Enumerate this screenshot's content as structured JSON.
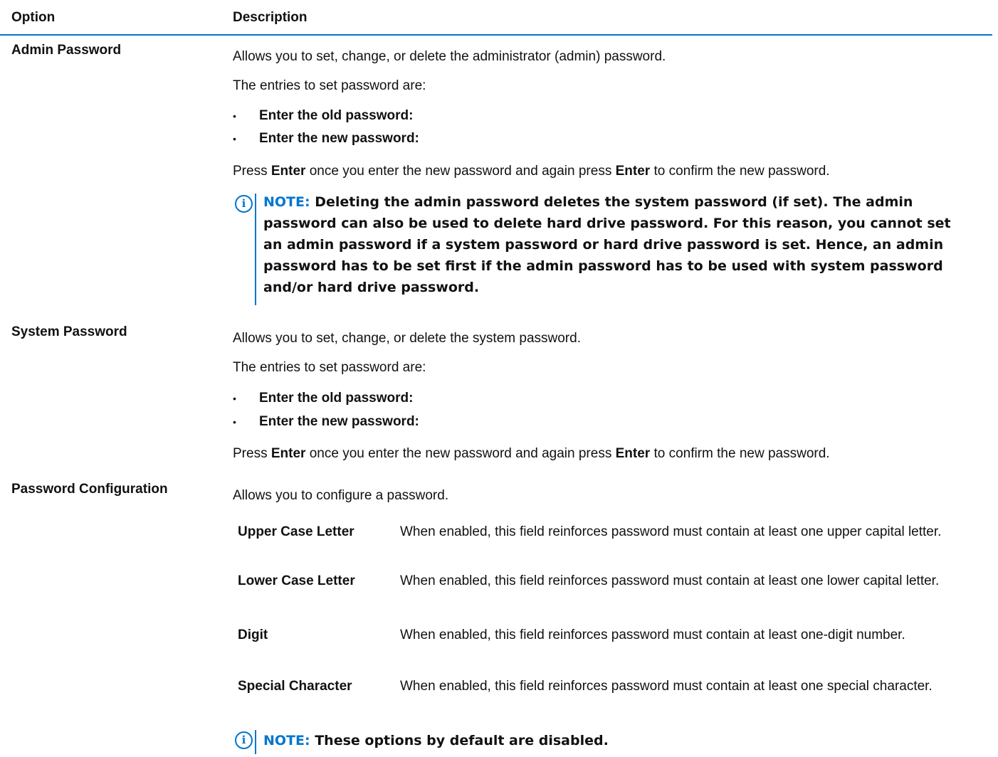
{
  "header": {
    "option": "Option",
    "description": "Description"
  },
  "admin": {
    "name": "Admin Password",
    "desc": "Allows you to set, change, or delete the administrator (admin) password.",
    "entries_intro": "The entries to set password are:",
    "bullets": [
      "Enter the old password:",
      "Enter the new password:"
    ],
    "press_pre": "Press ",
    "press_key1": "Enter",
    "press_mid": " once you enter the new password and again press ",
    "press_key2": "Enter",
    "press_post": " to confirm the new password.",
    "note_label": "NOTE:",
    "note_lines": [
      " Deleting the admin password deletes the system password (if set). The admin",
      "password can also be used to delete hard drive password. For this reason, you cannot set",
      "an admin password if a system password or hard drive password is set. Hence, an admin",
      "password has to be set first if the admin password has to be used with system password",
      "and/or hard drive password."
    ]
  },
  "system": {
    "name": "System Password",
    "desc": "Allows you to set, change, or delete the system password.",
    "entries_intro": "The entries to set password are:",
    "bullets": [
      "Enter the old password:",
      "Enter the new password:"
    ],
    "press_pre": "Press ",
    "press_key1": "Enter",
    "press_mid": " once you enter the new password and again press ",
    "press_key2": "Enter",
    "press_post": " to confirm the new password."
  },
  "config": {
    "name": "Password Configuration",
    "desc": "Allows you to configure a password.",
    "items": [
      {
        "name": "Upper Case Letter",
        "desc": "When enabled, this field reinforces password must contain at least one upper capital letter."
      },
      {
        "name": "Lower Case Letter",
        "desc": "When enabled, this field reinforces password must contain at least one lower capital letter."
      },
      {
        "name": "Digit",
        "desc": "When enabled, this field reinforces password must contain at least one-digit number."
      },
      {
        "name": "Special Character",
        "desc": "When enabled, this field reinforces password must contain at least one special character."
      }
    ],
    "note_label": "NOTE:",
    "note_text": " These options by default are disabled."
  },
  "icons": {
    "note": "info-icon"
  },
  "colors": {
    "accent": "#0076ce"
  }
}
